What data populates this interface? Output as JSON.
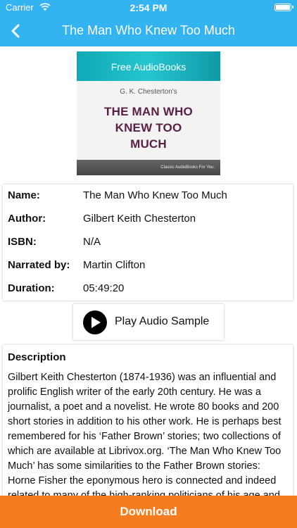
{
  "status_bar": {
    "carrier": "Carrier",
    "time": "2:54 PM"
  },
  "nav": {
    "title": "The Man Who Knew Too Much"
  },
  "cover": {
    "band_text": "Free AudioBooks",
    "author": "G. K. Chesterton's",
    "title_line1": "THE MAN WHO",
    "title_line2": "KNEW TOO",
    "title_line3": "MUCH",
    "footer_text": "Classic AudioBooks For You."
  },
  "info": [
    {
      "label": "Name:",
      "value": "The Man Who Knew Too Much"
    },
    {
      "label": "Author:",
      "value": "Gilbert Keith Chesterton"
    },
    {
      "label": "ISBN:",
      "value": "N/A"
    },
    {
      "label": "Narrated by:",
      "value": "Martin Clifton"
    },
    {
      "label": "Duration:",
      "value": "05:49:20"
    }
  ],
  "play_button": {
    "label": "Play Audio Sample"
  },
  "description": {
    "heading": "Description",
    "text": "Gilbert Keith Chesterton (1874-1936) was an influential and prolific English writer of the early 20th century. He was a journalist, a poet and a novelist. He wrote 80 books and 200 short stories in addition to his other work. He is perhaps best remembered for his ‘Father Brown’ stories; two collections of which are available at Librivox.org. ‘The Man Who Knew Too Much’ has some similarities to the Father Brown stories: Horne Fisher the eponymous hero is connected and indeed related to many of the high-ranking politicians of his age and thus ‘knows too much’"
  },
  "download_button": {
    "label": "Download"
  },
  "colors": {
    "accent": "#33b3f0",
    "download": "#f57c1f",
    "cover_title": "#5a2144"
  }
}
